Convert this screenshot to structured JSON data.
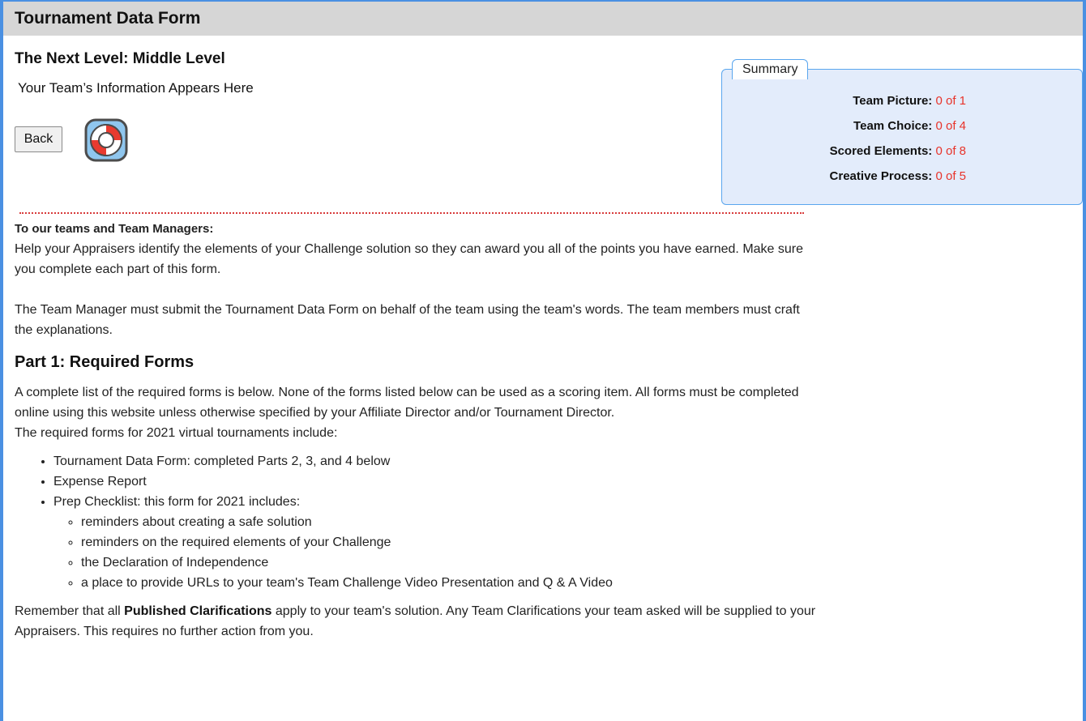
{
  "header": {
    "title": "Tournament Data Form"
  },
  "level": {
    "title": "The Next Level: Middle Level",
    "team_info": "Your Team’s Information Appears Here"
  },
  "actions": {
    "back_label": "Back",
    "help_icon": "lifebuoy-icon"
  },
  "summary": {
    "legend": "Summary",
    "rows": [
      {
        "label": "Team Picture:",
        "value": "0 of 1"
      },
      {
        "label": "Team Choice:",
        "value": "0 of 4"
      },
      {
        "label": "Scored Elements:",
        "value": "0 of 8"
      },
      {
        "label": "Creative Process:",
        "value": "0 of 5"
      }
    ],
    "value_color": "#e8332a"
  },
  "intro": {
    "heading": "To our teams and Team Managers:",
    "p1": "Help your Appraisers identify the elements of your Challenge solution so they can award you all of the points you have earned. Make sure you complete each part of this form.",
    "p2": "The Team Manager must submit the Tournament Data Form on behalf of the team using the team's words. The team members must craft the explanations."
  },
  "part1": {
    "heading": "Part 1: Required Forms",
    "p1": "A complete list of the required forms is below. None of the forms listed below can be used as a scoring item. All forms must be completed online using this website unless otherwise specified by your Affiliate Director and/or Tournament Director.",
    "p2": "The required forms for 2021 virtual tournaments include:",
    "items": [
      "Tournament Data Form: completed Parts 2, 3, and 4 below",
      "Expense Report",
      "Prep Checklist: this form for 2021 includes:"
    ],
    "subitems": [
      "reminders about creating a safe solution",
      "reminders on the required elements of your Challenge",
      "the Declaration of Independence",
      "a place to provide URLs to your team's Team Challenge Video Presentation and Q & A Video"
    ],
    "remember_prefix": "Remember that all ",
    "remember_bold": "Published Clarifications",
    "remember_suffix": " apply to your team's solution. Any Team Clarifications your team asked will be supplied to your Appraisers. This requires no further action from you."
  }
}
